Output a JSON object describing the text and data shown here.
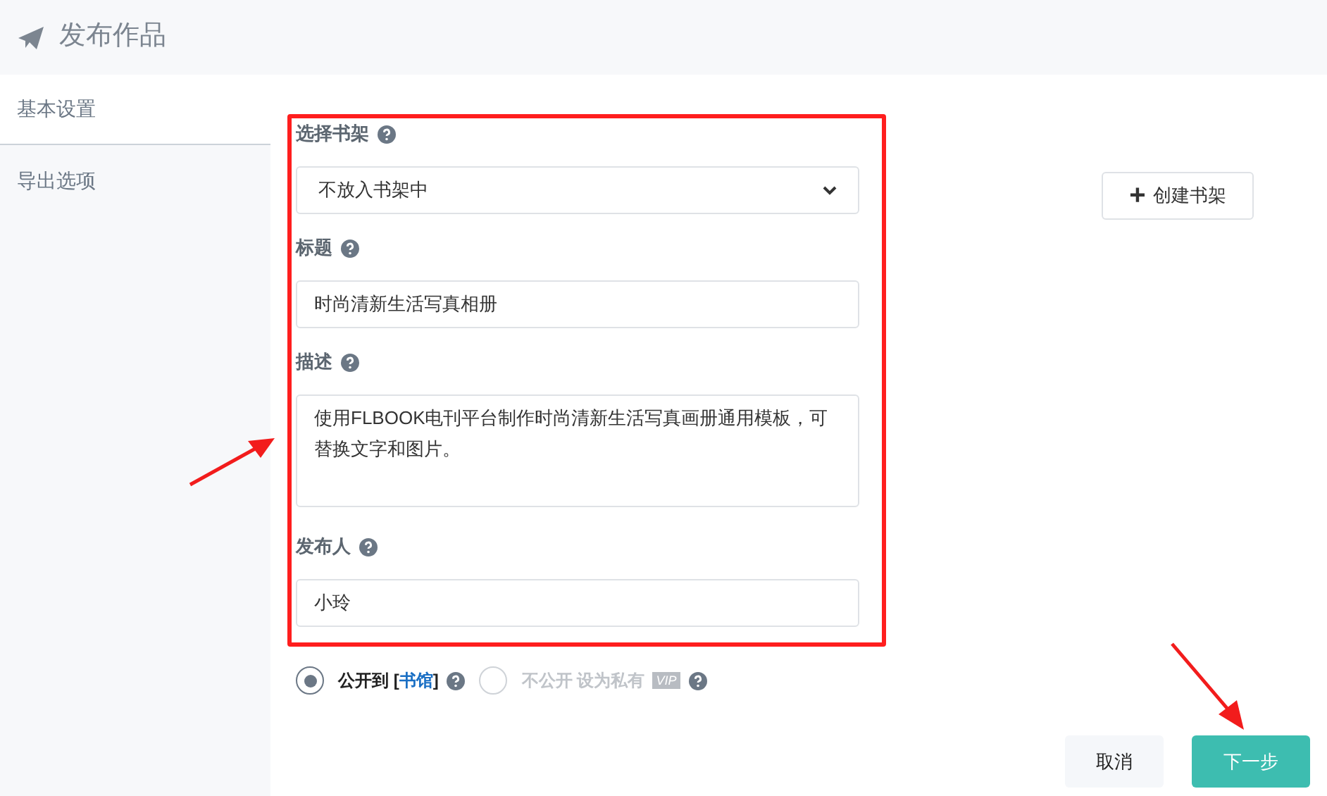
{
  "header": {
    "title": "发布作品"
  },
  "sidebar": {
    "items": [
      {
        "label": "基本设置",
        "selected": true
      },
      {
        "label": "导出选项",
        "selected": false
      }
    ]
  },
  "form": {
    "shelf": {
      "label": "选择书架",
      "value": "不放入书架中"
    },
    "title": {
      "label": "标题",
      "value": "时尚清新生活写真相册"
    },
    "description": {
      "label": "描述",
      "value": "使用FLBOOK电刊平台制作时尚清新生活写真画册通用模板，可替换文字和图片。"
    },
    "publisher": {
      "label": "发布人",
      "value": "小玲"
    }
  },
  "create_shelf_button": {
    "icon": "+",
    "label": "创建书架"
  },
  "visibility": [
    {
      "selected": true,
      "label": "公开到 [",
      "link": "书馆",
      "suffix": "]"
    },
    {
      "selected": false,
      "label": "不公开 设为私有",
      "badge": "VIP"
    }
  ],
  "buttons": [
    {
      "kind": "secondary",
      "label": "取消"
    },
    {
      "kind": "primary",
      "label": "下一步"
    }
  ]
}
